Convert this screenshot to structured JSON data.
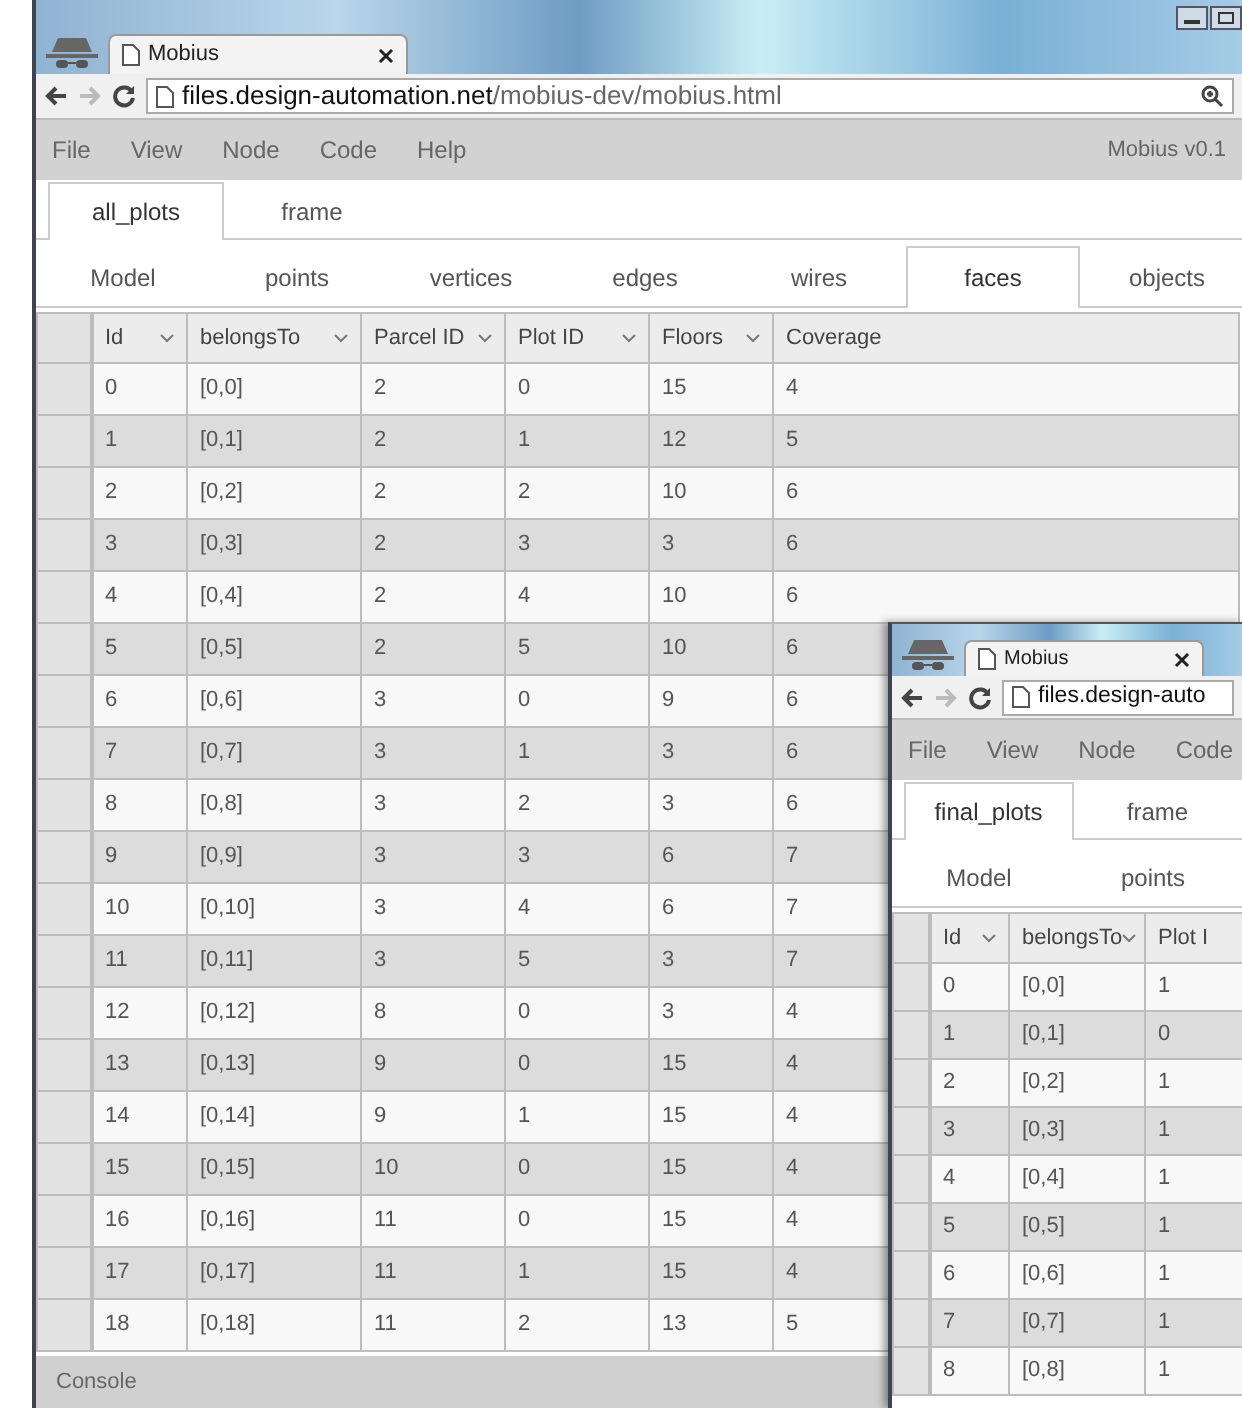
{
  "windows": [
    {
      "tab_title": "Mobius",
      "url_host": "files.design-automation.net",
      "url_path": "/mobius-dev/mobius.html",
      "menu": [
        "File",
        "View",
        "Node",
        "Code",
        "Help"
      ],
      "version": "Mobius v0.1",
      "sheet_tabs": [
        {
          "label": "all_plots",
          "selected": true
        },
        {
          "label": "frame",
          "selected": false
        }
      ],
      "entity_tabs": [
        {
          "label": "Model",
          "selected": false
        },
        {
          "label": "points",
          "selected": false
        },
        {
          "label": "vertices",
          "selected": false
        },
        {
          "label": "edges",
          "selected": false
        },
        {
          "label": "wires",
          "selected": false
        },
        {
          "label": "faces",
          "selected": true
        },
        {
          "label": "objects",
          "selected": false
        }
      ],
      "table": {
        "columns": [
          {
            "label": "Id",
            "sortable": true
          },
          {
            "label": "belongsTo",
            "sortable": true
          },
          {
            "label": "Parcel ID",
            "sortable": true
          },
          {
            "label": "Plot ID",
            "sortable": true
          },
          {
            "label": "Floors",
            "sortable": true
          },
          {
            "label": "Coverage",
            "sortable": false
          }
        ],
        "rows": [
          [
            "0",
            "[0,0]",
            "2",
            "0",
            "15",
            "4"
          ],
          [
            "1",
            "[0,1]",
            "2",
            "1",
            "12",
            "5"
          ],
          [
            "2",
            "[0,2]",
            "2",
            "2",
            "10",
            "6"
          ],
          [
            "3",
            "[0,3]",
            "2",
            "3",
            "3",
            "6"
          ],
          [
            "4",
            "[0,4]",
            "2",
            "4",
            "10",
            "6"
          ],
          [
            "5",
            "[0,5]",
            "2",
            "5",
            "10",
            "6"
          ],
          [
            "6",
            "[0,6]",
            "3",
            "0",
            "9",
            "6"
          ],
          [
            "7",
            "[0,7]",
            "3",
            "1",
            "3",
            "6"
          ],
          [
            "8",
            "[0,8]",
            "3",
            "2",
            "3",
            "6"
          ],
          [
            "9",
            "[0,9]",
            "3",
            "3",
            "6",
            "7"
          ],
          [
            "10",
            "[0,10]",
            "3",
            "4",
            "6",
            "7"
          ],
          [
            "11",
            "[0,11]",
            "3",
            "5",
            "3",
            "7"
          ],
          [
            "12",
            "[0,12]",
            "8",
            "0",
            "3",
            "4"
          ],
          [
            "13",
            "[0,13]",
            "9",
            "0",
            "15",
            "4"
          ],
          [
            "14",
            "[0,14]",
            "9",
            "1",
            "15",
            "4"
          ],
          [
            "15",
            "[0,15]",
            "10",
            "0",
            "15",
            "4"
          ],
          [
            "16",
            "[0,16]",
            "11",
            "0",
            "15",
            "4"
          ],
          [
            "17",
            "[0,17]",
            "11",
            "1",
            "15",
            "4"
          ],
          [
            "18",
            "[0,18]",
            "11",
            "2",
            "13",
            "5"
          ]
        ]
      },
      "console": "Console"
    },
    {
      "tab_title": "Mobius",
      "url_host": "files.design-auto",
      "menu": [
        "File",
        "View",
        "Node",
        "Code"
      ],
      "sheet_tabs": [
        {
          "label": "final_plots",
          "selected": true
        },
        {
          "label": "frame",
          "selected": false
        }
      ],
      "entity_tabs": [
        {
          "label": "Model",
          "selected": false
        },
        {
          "label": "points",
          "selected": false
        }
      ],
      "table": {
        "columns": [
          {
            "label": "Id",
            "sortable": true
          },
          {
            "label": "belongsTo",
            "sortable": true
          },
          {
            "label": "Plot I"
          }
        ],
        "rows": [
          [
            "0",
            "[0,0]",
            "1"
          ],
          [
            "1",
            "[0,1]",
            "0"
          ],
          [
            "2",
            "[0,2]",
            "1"
          ],
          [
            "3",
            "[0,3]",
            "1"
          ],
          [
            "4",
            "[0,4]",
            "1"
          ],
          [
            "5",
            "[0,5]",
            "1"
          ],
          [
            "6",
            "[0,6]",
            "1"
          ],
          [
            "7",
            "[0,7]",
            "1"
          ],
          [
            "8",
            "[0,8]",
            "1"
          ]
        ]
      }
    }
  ]
}
